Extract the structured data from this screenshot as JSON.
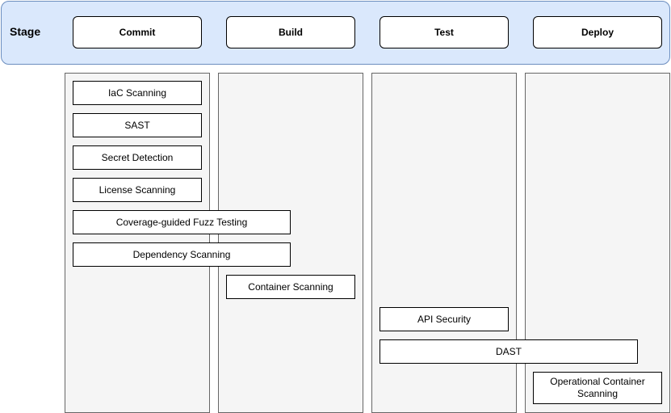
{
  "header": {
    "label": "Stage",
    "stages": [
      {
        "label": "Commit"
      },
      {
        "label": "Build"
      },
      {
        "label": "Test"
      },
      {
        "label": "Deploy"
      }
    ]
  },
  "scans": {
    "iac": "IaC Scanning",
    "sast": "SAST",
    "secret": "Secret Detection",
    "license": "License Scanning",
    "fuzz": "Coverage-guided Fuzz Testing",
    "dependency": "Dependency Scanning",
    "container": "Container Scanning",
    "api": "API Security",
    "dast": "DAST",
    "operational": "Operational Container Scanning"
  },
  "colors": {
    "header_fill": "#dae8fc",
    "header_border": "#6c8ebf",
    "column_fill": "#f5f5f5",
    "column_border": "#666666"
  }
}
